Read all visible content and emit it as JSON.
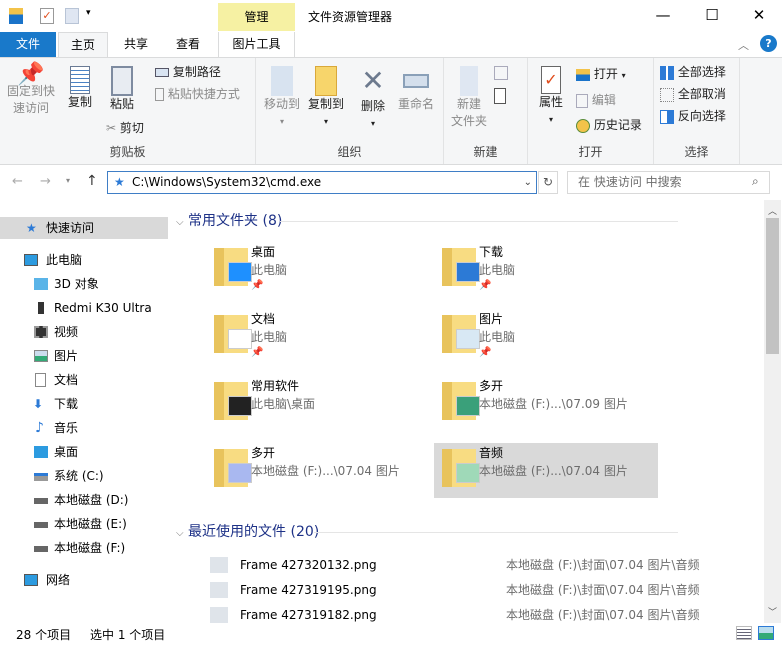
{
  "window": {
    "title": "文件资源管理器",
    "context_tab": "管理",
    "minimize": "—",
    "maximize": "☐",
    "close": "✕"
  },
  "tabs": [
    {
      "label": "文件"
    },
    {
      "label": "主页"
    },
    {
      "label": "共享"
    },
    {
      "label": "查看"
    },
    {
      "label": "图片工具"
    }
  ],
  "ribbon": {
    "clipboard": {
      "label": "剪贴板",
      "pin": "固定到快",
      "pin2": "速访问",
      "copy": "复制",
      "paste": "粘贴",
      "copy_path": "复制路径",
      "paste_shortcut": "粘贴快捷方式",
      "cut": "剪切"
    },
    "organize": {
      "label": "组织",
      "move_to": "移动到",
      "copy_to": "复制到",
      "delete": "删除",
      "rename": "重命名"
    },
    "new": {
      "label": "新建",
      "new_folder": "新建",
      "new_folder2": "文件夹"
    },
    "open": {
      "label": "打开",
      "properties": "属性",
      "open": "打开",
      "edit": "编辑",
      "history": "历史记录"
    },
    "select": {
      "label": "选择",
      "select_all": "全部选择",
      "select_none": "全部取消",
      "invert": "反向选择"
    }
  },
  "address": {
    "path": "C:\\Windows\\System32\\cmd.exe",
    "search_placeholder": "在 快速访问 中搜索"
  },
  "nav": [
    {
      "label": "快速访问"
    },
    {
      "label": "此电脑"
    },
    {
      "label": "3D 对象"
    },
    {
      "label": "Redmi K30 Ultra"
    },
    {
      "label": "视频"
    },
    {
      "label": "图片"
    },
    {
      "label": "文档"
    },
    {
      "label": "下载"
    },
    {
      "label": "音乐"
    },
    {
      "label": "桌面"
    },
    {
      "label": "系统 (C:)"
    },
    {
      "label": "本地磁盘 (D:)"
    },
    {
      "label": "本地磁盘 (E:)"
    },
    {
      "label": "本地磁盘 (F:)"
    },
    {
      "label": "网络"
    }
  ],
  "frequent": {
    "title": "常用文件夹 (8)",
    "items": [
      {
        "name": "桌面",
        "sub": "此电脑",
        "pinned": true
      },
      {
        "name": "下载",
        "sub": "此电脑",
        "pinned": true
      },
      {
        "name": "文档",
        "sub": "此电脑",
        "pinned": true
      },
      {
        "name": "图片",
        "sub": "此电脑",
        "pinned": true
      },
      {
        "name": "常用软件",
        "sub": "此电脑\\桌面"
      },
      {
        "name": "多开",
        "sub": "本地磁盘 (F:)...\\07.09 图片"
      },
      {
        "name": "多开",
        "sub": "本地磁盘 (F:)...\\07.04 图片"
      },
      {
        "name": "音频",
        "sub": "本地磁盘 (F:)...\\07.04 图片",
        "selected": true
      }
    ]
  },
  "recent": {
    "title": "最近使用的文件 (20)",
    "items": [
      {
        "name": "Frame 427320132.png",
        "path": "本地磁盘 (F:)\\封面\\07.04 图片\\音频"
      },
      {
        "name": "Frame 427319195.png",
        "path": "本地磁盘 (F:)\\封面\\07.04 图片\\音频"
      },
      {
        "name": "Frame 427319182.png",
        "path": "本地磁盘 (F:)\\封面\\07.04 图片\\音频"
      }
    ]
  },
  "status": {
    "count": "28 个项目",
    "selected": "选中 1 个项目"
  },
  "colors": {
    "accent": "#1979ca",
    "manage": "#f6f1a3",
    "section": "#1e3287",
    "selection": "#d9d9d9"
  }
}
